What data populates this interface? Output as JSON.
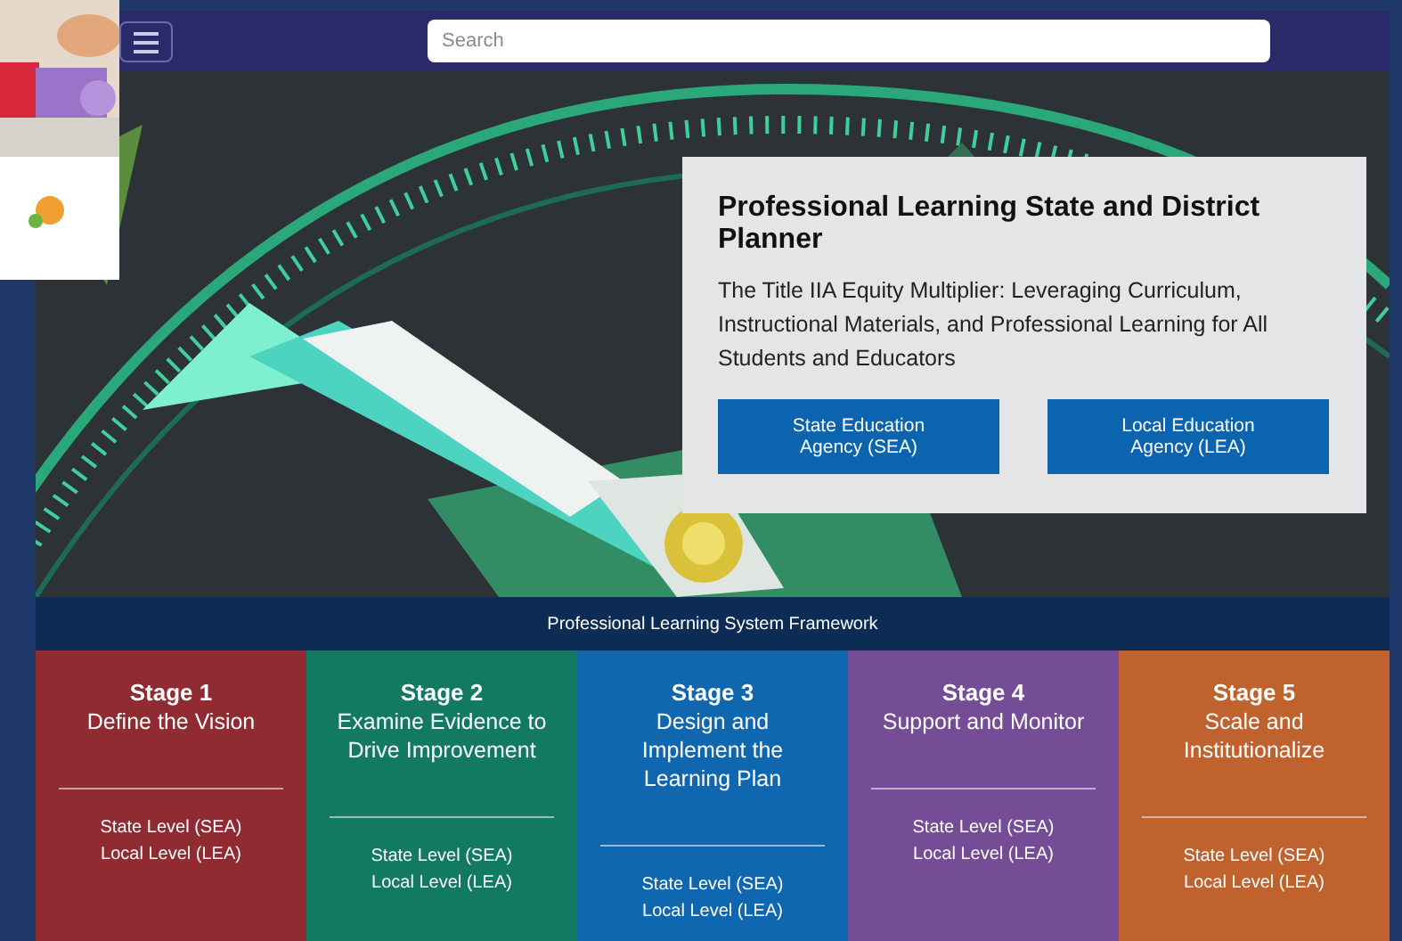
{
  "header": {
    "search": {
      "placeholder": "Search"
    }
  },
  "hero": {
    "card": {
      "title": "Professional Learning State and District Planner",
      "subtitle": "The Title IIA Equity Multiplier: Leveraging Curriculum, Instructional Materials, and Professional Learning for All Students and Educators",
      "buttons": [
        "State Education Agency (SEA)",
        "Local Education Agency (LEA)"
      ]
    }
  },
  "framework": {
    "title": "Professional Learning System Framework",
    "stages": [
      {
        "label": "Stage 1",
        "title": "Define the Vision",
        "color": "#8f2b31",
        "links": [
          "State Level (SEA)",
          "Local Level (LEA)"
        ]
      },
      {
        "label": "Stage 2",
        "title": "Examine Evidence to Drive Improvement",
        "color": "#127a63",
        "links": [
          "State Level (SEA)",
          "Local Level (LEA)"
        ]
      },
      {
        "label": "Stage 3",
        "title": "Design and Implement the Learning Plan",
        "color": "#0f67b0",
        "links": [
          "State Level (SEA)",
          "Local Level (LEA)"
        ]
      },
      {
        "label": "Stage 4",
        "title": "Support and Monitor",
        "color": "#744d96",
        "links": [
          "State Level (SEA)",
          "Local Level (LEA)"
        ]
      },
      {
        "label": "Stage 5",
        "title": "Scale and Institutionalize",
        "color": "#c0622d",
        "links": [
          "State Level (SEA)",
          "Local Level (LEA)"
        ]
      }
    ]
  }
}
